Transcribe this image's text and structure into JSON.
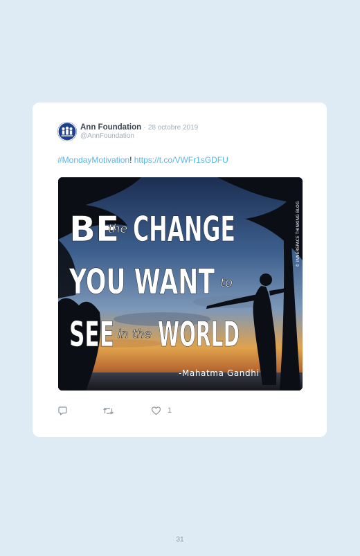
{
  "tweet": {
    "author_name": "Ann Foundation",
    "separator": "·",
    "date": "28 octobre 2019",
    "handle": "@AnnFoundation",
    "hashtag": "#MondayMotivation",
    "exclamation": "!",
    "link": "https://t.co/VWFr1sGDFU",
    "image": {
      "line1_big_a": "BE",
      "line1_small": "the",
      "line1_big_b": "CHANGE",
      "line2_big": "YOU WANT",
      "line2_small": "to",
      "line3_big_a": "SEE",
      "line3_small": "in the",
      "line3_big_b": "WORLD",
      "attribution": "-Mahatma Gandhi",
      "watermark": "© INNERSPACE THINKING BLOG"
    },
    "actions": {
      "reply_icon": "reply-icon",
      "retweet_icon": "retweet-icon",
      "like_icon": "heart-icon",
      "like_count": "1"
    }
  },
  "page_number": "31",
  "colors": {
    "page_background": "#deebf4",
    "card_background": "#ffffff",
    "link": "#58b5e8",
    "muted": "#a3adb7",
    "avatar": "#1f3f8f"
  }
}
